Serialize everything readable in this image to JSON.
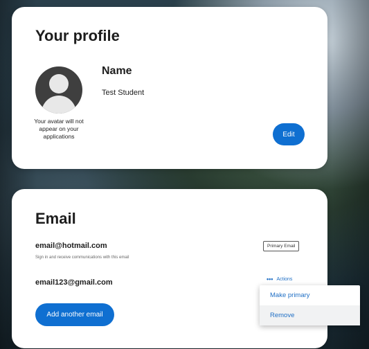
{
  "profile": {
    "title": "Your profile",
    "avatar_note": "Your avatar will not appear on your applications",
    "name_label": "Name",
    "name_value": "Test Student",
    "edit_label": "Edit"
  },
  "email": {
    "title": "Email",
    "primary_email": "email@hotmail.com",
    "primary_note": "Sign in and receive communications with this email",
    "primary_badge": "Primary Email",
    "secondary_email": "email123@gmail.com",
    "actions_dots": "•••",
    "actions_label": "Actions",
    "add_button": "Add another email"
  },
  "actions_menu": {
    "items": [
      {
        "label": "Make primary"
      },
      {
        "label": "Remove"
      }
    ]
  },
  "icons": {
    "avatar": "default-avatar-icon",
    "actions": "ellipsis-icon"
  },
  "colors": {
    "accent": "#0f6fd1",
    "link": "#1f6fc5",
    "card_bg": "#ffffff",
    "avatar_bg": "#3f3f3f"
  }
}
